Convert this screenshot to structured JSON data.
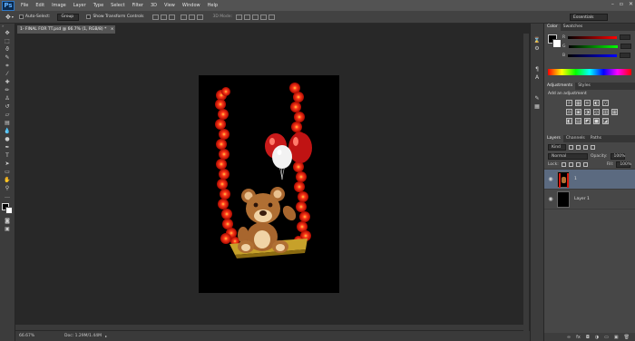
{
  "app": {
    "logo": "Ps"
  },
  "menu": [
    "File",
    "Edit",
    "Image",
    "Layer",
    "Type",
    "Select",
    "Filter",
    "3D",
    "View",
    "Window",
    "Help"
  ],
  "window_controls": {
    "minimize": "–",
    "restore": "▫",
    "close": "✕"
  },
  "options": {
    "auto_select_label": "Auto-Select:",
    "auto_select_value": "Group",
    "transform_label": "Show Transform Controls",
    "mode_3d_label": "3D Mode:",
    "workspace": "Essentials"
  },
  "document": {
    "tab_title": "1- FINAL FOR TT.psd @ 66.7% (1, RGB/8) *",
    "tab_close": "×",
    "zoom": "66.67%",
    "doc_info": "Doc: 1.29M/1.44M"
  },
  "colors": {
    "accent_blue": "#3d6fb6",
    "canvas": "#000000",
    "flower_red": "#d8160e"
  },
  "color_panel": {
    "tabs": [
      "Color",
      "Swatches"
    ],
    "sliders": [
      {
        "label": "R",
        "value": ""
      },
      {
        "label": "G",
        "value": ""
      },
      {
        "label": "B",
        "value": ""
      }
    ]
  },
  "adjustments_panel": {
    "tabs": [
      "Adjustments",
      "Styles"
    ],
    "heading": "Add an adjustment",
    "row1": [
      "☼",
      "▦",
      "≋",
      "◐",
      "▽"
    ],
    "row2": [
      "⚖",
      "▣",
      "◑",
      "◎",
      "▥",
      "▦"
    ],
    "row3": [
      "◧",
      "▤",
      "◩",
      "■",
      "◪"
    ]
  },
  "layers_panel": {
    "tabs": [
      "Layers",
      "Channels",
      "Paths"
    ],
    "kind_label": "Kind",
    "blend_mode": "Normal",
    "opacity_label": "Opacity:",
    "opacity_value": "100%",
    "lock_label": "Lock:",
    "fill_label": "Fill:",
    "fill_value": "100%",
    "layers": [
      {
        "name": "1",
        "selected": true
      },
      {
        "name": "Layer 1",
        "selected": false
      }
    ]
  }
}
